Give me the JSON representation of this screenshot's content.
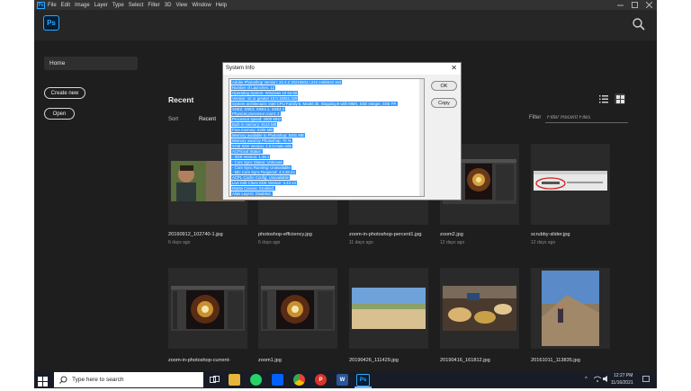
{
  "menubar": {
    "items": [
      "File",
      "Edit",
      "Image",
      "Layer",
      "Type",
      "Select",
      "Filter",
      "3D",
      "View",
      "Window",
      "Help"
    ]
  },
  "app": {
    "logo_text": "Ps",
    "mini_logo_text": "Ps"
  },
  "sidebar": {
    "home_label": "Home",
    "create_new_label": "Create new",
    "open_label": "Open"
  },
  "recent": {
    "title": "Recent",
    "sort_label": "Sort",
    "sort_value": "Recent",
    "filter_label": "Filter",
    "filter_placeholder": "Filter Recent Files",
    "files": [
      {
        "name": "20160912_102740-1.jpg",
        "age": "6 days ago"
      },
      {
        "name": "photoshop-efficiency.jpg",
        "age": "6 days ago"
      },
      {
        "name": "zoom-in-photoshop-percent1.jpg",
        "age": "11 days ago"
      },
      {
        "name": "zoom2.jpg",
        "age": "12 days ago"
      },
      {
        "name": "scrubby-slider.jpg",
        "age": "12 days ago"
      },
      {
        "name": "zoom-in-photoshop-current-",
        "age": ""
      },
      {
        "name": "zoom1.jpg",
        "age": ""
      },
      {
        "name": "20190426_111429.jpg",
        "age": ""
      },
      {
        "name": "20190416_161812.jpg",
        "age": ""
      },
      {
        "name": "20161011_113835.jpg",
        "age": ""
      }
    ]
  },
  "dialog": {
    "title": "System Info",
    "ok_label": "OK",
    "copy_label": "Copy",
    "close_glyph": "✕",
    "lines": [
      "Adobe Photoshop Version: 22.4.2 20210602.r.242 e45b042  x64",
      "Number of Launches: 12",
      "Operating System: Windows 10 64-bit",
      "Version: 10 or greater 10.0.18362.329",
      "System architecture: Intel CPU Family:6, Model:30, Stepping:9 with MMX, SSE Integer, SSE FP,",
      "SSE2, SSE3, SSE4.1, SSE4.2",
      "Physical processor count: 2",
      "Processor speed: 2900 MHz",
      "Built-in memory: 8144 MB",
      "Free memory: 5205 MB",
      "Memory available to Photoshop: 5491 MB",
      "Memory used by Photoshop: 70 %",
      "SAM SDK Version: 2.0.0-main.165",
      "ACP.local Status:",
      "  - SDK Version: 1.45.1",
      "  - Core Sync Status: Unknown",
      "  - Core Sync Running: Unavailable",
      "  - Min Core Sync Required: 4.3.28.24",
      "ACPL Cache Config: Unavailable",
      "Live Edit Client SDK Version: 3.40.13",
      "Manta Canvas: Enabled.",
      "Alias Layers: Disabled."
    ]
  },
  "taskbar": {
    "search_placeholder": "Type here to search",
    "time": "12:27 PM",
    "date": "11/16/2021",
    "apps": [
      "task-view",
      "file-explorer",
      "whatsapp",
      "dropbox",
      "chrome",
      "pdf-app",
      "word",
      "photoshop"
    ]
  },
  "colors": {
    "ps_blue": "#31a8ff",
    "selection_blue": "#3399ff",
    "app_background": "#1e1e1e"
  }
}
